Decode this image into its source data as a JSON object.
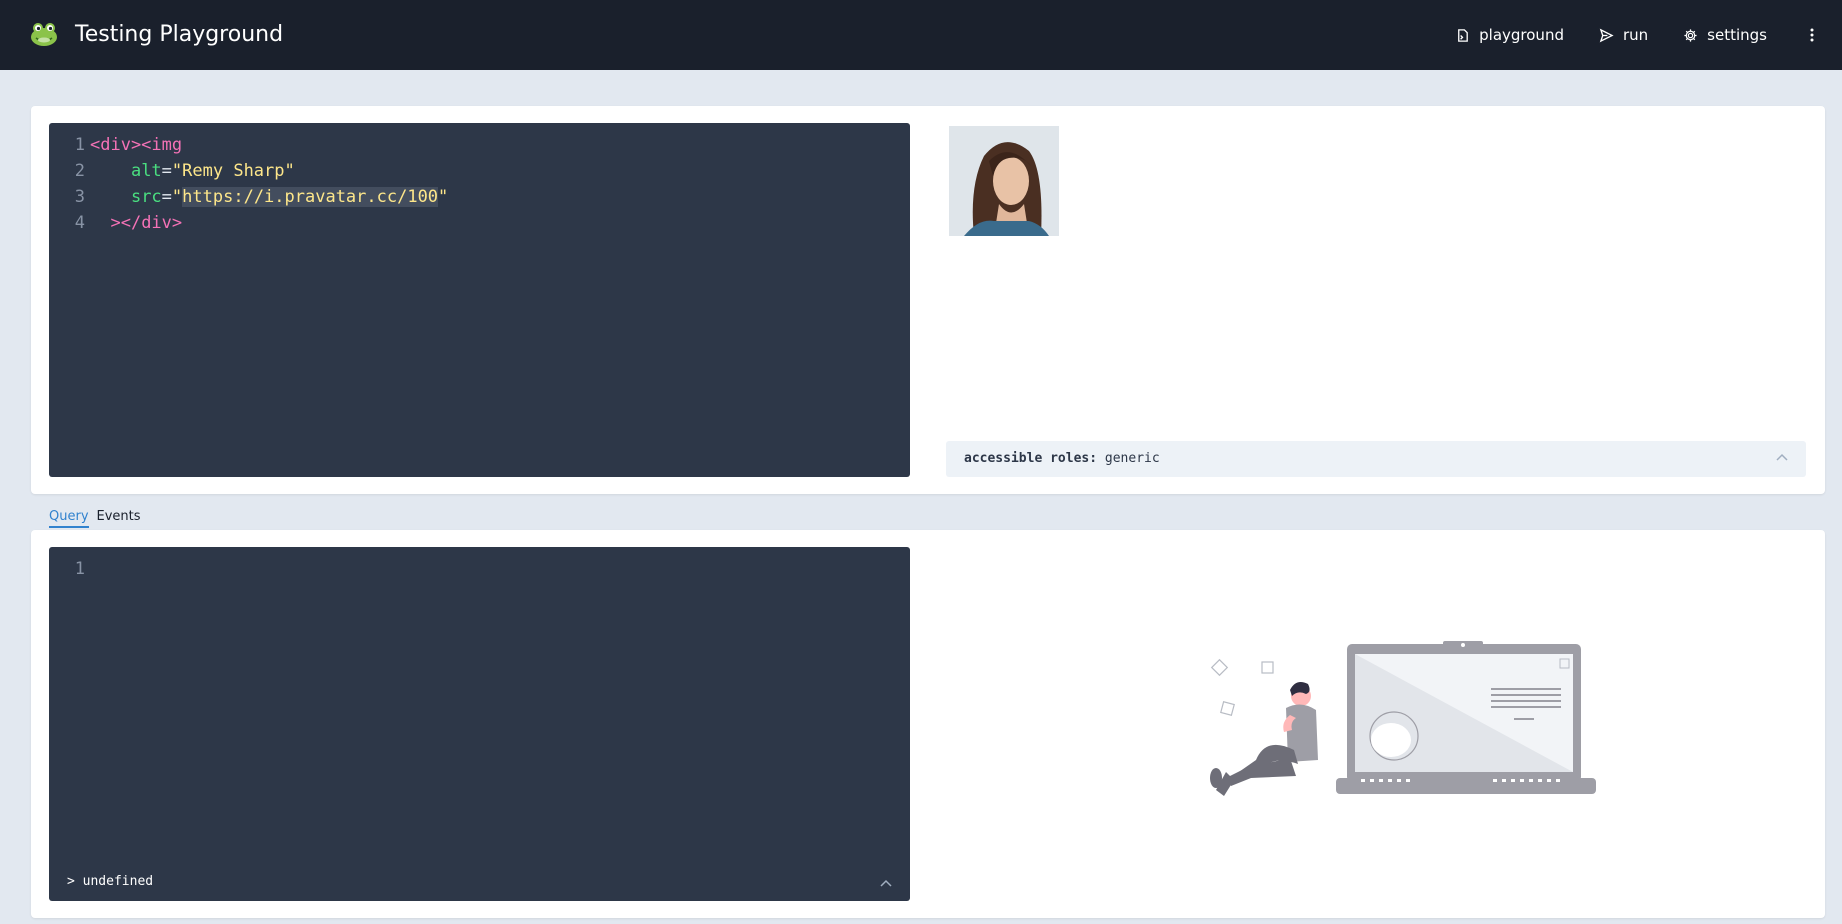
{
  "header": {
    "title": "Testing Playground",
    "nav": [
      {
        "label": "playground",
        "icon": "playground-icon"
      },
      {
        "label": "run",
        "icon": "send-icon"
      },
      {
        "label": "settings",
        "icon": "gear-icon"
      }
    ]
  },
  "markup_editor": {
    "lines": [
      {
        "num": "1"
      },
      {
        "num": "2",
        "attr": "alt",
        "value": "\"Remy Sharp\""
      },
      {
        "num": "3",
        "attr": "src",
        "quote": "\"",
        "url": "https://i.pravatar.cc/100",
        "end_quote": "\""
      },
      {
        "num": "4"
      }
    ],
    "open_tags": "<div><img",
    "close_tags": "></div>",
    "eq": "="
  },
  "preview": {
    "avatar_alt": "Remy Sharp",
    "roles_label": "accessible roles:",
    "roles_value": "generic"
  },
  "tabs": [
    {
      "label": "Query",
      "active": true
    },
    {
      "label": "Events",
      "active": false
    }
  ],
  "query_editor": {
    "line_num": "1",
    "result": "> undefined"
  },
  "colors": {
    "header_bg": "#1a202c",
    "page_bg": "#e2e8f0",
    "editor_bg": "#2d3748",
    "accent": "#3182ce"
  }
}
